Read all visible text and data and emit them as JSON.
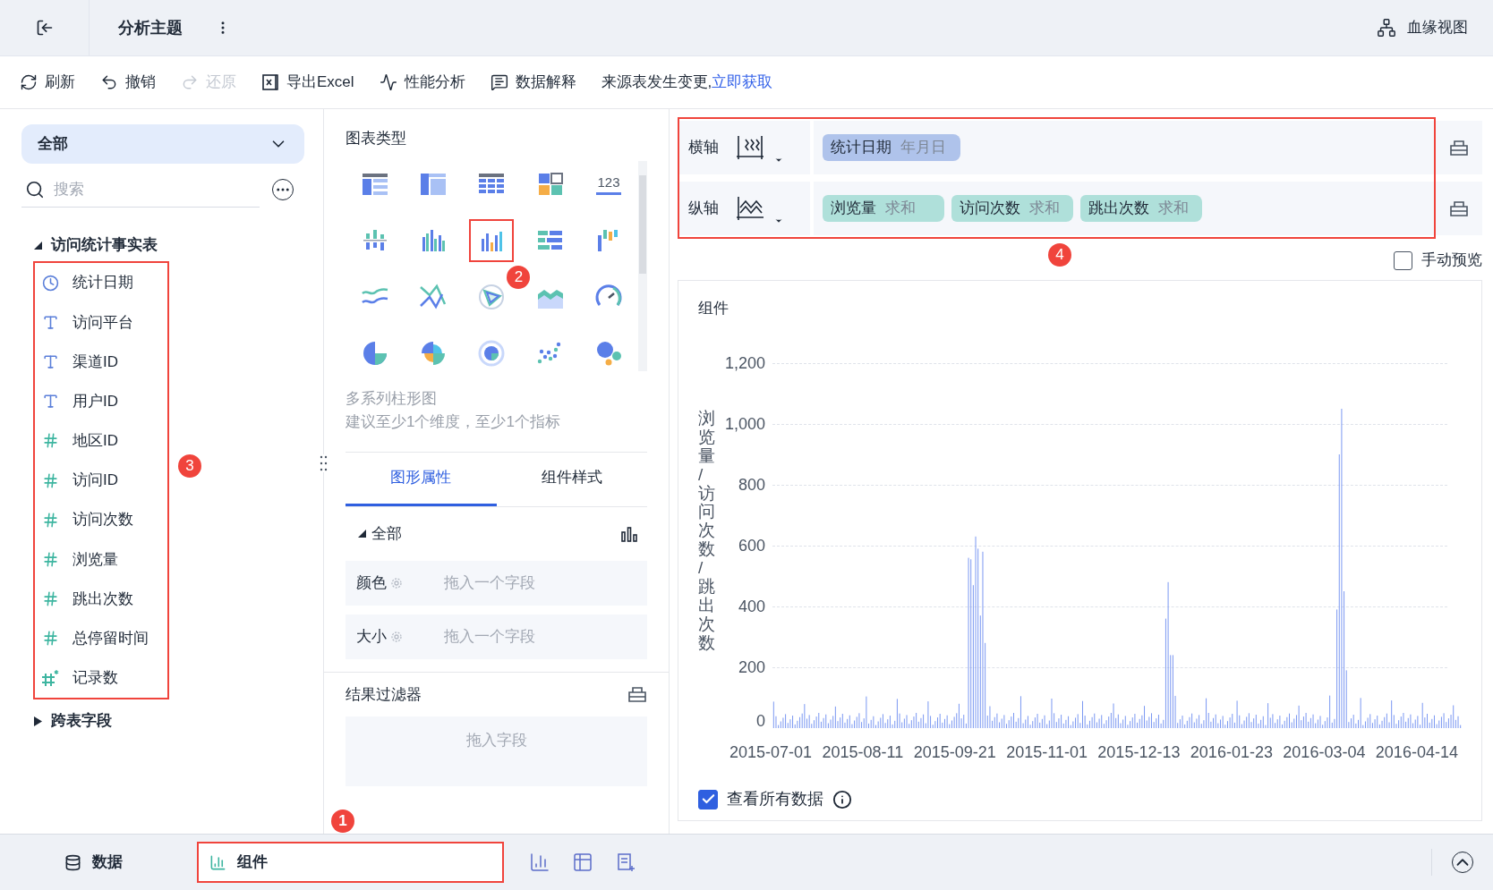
{
  "header": {
    "title": "分析主题",
    "lineage_button": "血缘视图"
  },
  "toolbar": [
    {
      "label": "刷新",
      "kind": "refresh",
      "disabled": false
    },
    {
      "label": "撤销",
      "kind": "undo",
      "disabled": false
    },
    {
      "label": "还原",
      "kind": "redo",
      "disabled": true
    },
    {
      "label": "导出Excel",
      "kind": "excel",
      "disabled": false
    },
    {
      "label": "性能分析",
      "kind": "perf",
      "disabled": false
    },
    {
      "label": "数据解释",
      "kind": "explain",
      "disabled": false
    }
  ],
  "notice": {
    "text": "来源表发生变更,",
    "link": "立即获取"
  },
  "data_panel": {
    "scope": "全部",
    "search_placeholder": "搜索",
    "fields_callout": "3",
    "tables": [
      {
        "name": "访问统计事实表",
        "expanded": true,
        "fields": [
          {
            "name": "统计日期",
            "kind": "date"
          },
          {
            "name": "访问平台",
            "kind": "text"
          },
          {
            "name": "渠道ID",
            "kind": "text"
          },
          {
            "name": "用户ID",
            "kind": "text"
          },
          {
            "name": "地区ID",
            "kind": "number"
          },
          {
            "name": "访问ID",
            "kind": "number"
          },
          {
            "name": "访问次数",
            "kind": "number"
          },
          {
            "name": "浏览量",
            "kind": "number"
          },
          {
            "name": "跳出次数",
            "kind": "number"
          },
          {
            "name": "总停留时间",
            "kind": "number"
          },
          {
            "name": "记录数",
            "kind": "count"
          }
        ]
      },
      {
        "name": "跨表字段",
        "expanded": false
      }
    ]
  },
  "chart_panel": {
    "title": "图表类型",
    "types": [
      {
        "kind": "table",
        "highlighted": false
      },
      {
        "kind": "crosstab",
        "highlighted": false
      },
      {
        "kind": "detail",
        "highlighted": false
      },
      {
        "kind": "treemap",
        "highlighted": false
      },
      {
        "kind": "kpi",
        "highlighted": false,
        "text": "123"
      },
      {
        "kind": "stacked",
        "highlighted": false
      },
      {
        "kind": "grouped",
        "highlighted": false
      },
      {
        "kind": "multibar",
        "highlighted": true,
        "callout": "2"
      },
      {
        "kind": "hbar",
        "highlighted": false
      },
      {
        "kind": "waterfall",
        "highlighted": false
      },
      {
        "kind": "line",
        "highlighted": false
      },
      {
        "kind": "polyline",
        "highlighted": false
      },
      {
        "kind": "radar",
        "highlighted": false
      },
      {
        "kind": "area",
        "highlighted": false
      },
      {
        "kind": "gauge",
        "highlighted": false
      },
      {
        "kind": "pie",
        "highlighted": false
      },
      {
        "kind": "rose",
        "highlighted": false
      },
      {
        "kind": "donut",
        "highlighted": false
      },
      {
        "kind": "scatter",
        "highlighted": false
      },
      {
        "kind": "bubble",
        "highlighted": false
      }
    ],
    "description": "多系列柱形图",
    "hint": "建议至少1个维度，至少1个指标",
    "tabs": [
      {
        "label": "图形属性",
        "selected": true
      },
      {
        "label": "组件样式",
        "selected": false
      }
    ],
    "section": {
      "label": "全部",
      "expanded": true
    },
    "properties": [
      {
        "label": "颜色",
        "placeholder": "拖入一个字段"
      },
      {
        "label": "大小",
        "placeholder": "拖入一个字段"
      }
    ]
  },
  "filter": {
    "title": "结果过滤器",
    "placeholder": "拖入字段"
  },
  "axes": {
    "callout": "4",
    "rows": [
      {
        "label": "横轴",
        "kind": "x",
        "pills": [
          {
            "field": "统计日期",
            "agg": "年月日",
            "kind": "dimension"
          }
        ]
      },
      {
        "label": "纵轴",
        "kind": "y",
        "pills": [
          {
            "field": "浏览量",
            "agg": "求和",
            "kind": "measure"
          },
          {
            "field": "访问次数",
            "agg": "求和",
            "kind": "measure"
          },
          {
            "field": "跳出次数",
            "agg": "求和",
            "kind": "measure"
          }
        ]
      }
    ]
  },
  "manual_preview": {
    "label": "手动预览",
    "checked": false
  },
  "chart": {
    "title": "组件",
    "ylabel": "浏览量/访问次数/跳出次数",
    "yticks": [
      "1,200",
      "1,000",
      "800",
      "600",
      "400",
      "200",
      "0"
    ],
    "xticks": [
      "2015-07-01",
      "2015-08-11",
      "2015-09-21",
      "2015-11-01",
      "2015-12-13",
      "2016-01-23",
      "2016-03-04",
      "2016-04-14"
    ]
  },
  "view_all": {
    "label": "查看所有数据",
    "checked": true
  },
  "bottom_tabs": [
    {
      "label": "数据",
      "kind": "data",
      "selected": false
    },
    {
      "label": "组件",
      "kind": "component",
      "selected": true,
      "callout": "1"
    }
  ]
}
